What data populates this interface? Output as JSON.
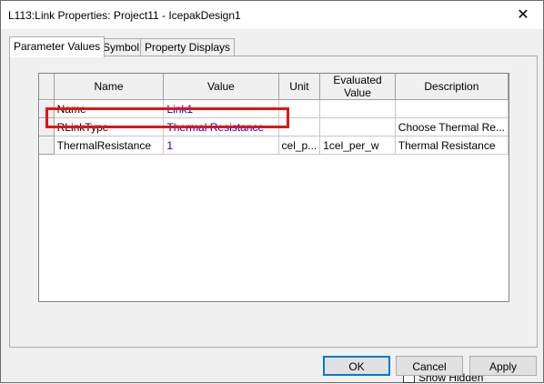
{
  "window": {
    "title": "L113:Link Properties: Project11 - IcepakDesign1",
    "close_glyph": "✕"
  },
  "tabs": [
    {
      "label": "Parameter Values",
      "active": true
    },
    {
      "label": "Symbol",
      "active": false
    },
    {
      "label": "Property Displays",
      "active": false
    }
  ],
  "table": {
    "columns": [
      "Name",
      "Value",
      "Unit",
      "Evaluated Value",
      "Description"
    ],
    "rows": [
      {
        "name": "Name",
        "value": "Link1",
        "unit": "",
        "evaluated": "",
        "description": ""
      },
      {
        "name": "RLinkType",
        "value": "Thermal Resistance",
        "unit": "",
        "evaluated": "",
        "description": "Choose Thermal Re..."
      },
      {
        "name": "ThermalResistance",
        "value": "1",
        "unit": "cel_p...",
        "evaluated": "1cel_per_w",
        "description": "Thermal Resistance"
      }
    ]
  },
  "show_hidden": {
    "label": "Show Hidden",
    "checked": false
  },
  "buttons": {
    "ok": "OK",
    "cancel": "Cancel",
    "apply": "Apply"
  },
  "colors": {
    "highlight": "#e0141a",
    "value_text": "#0000cc",
    "default_button_border": "#0078d7"
  }
}
